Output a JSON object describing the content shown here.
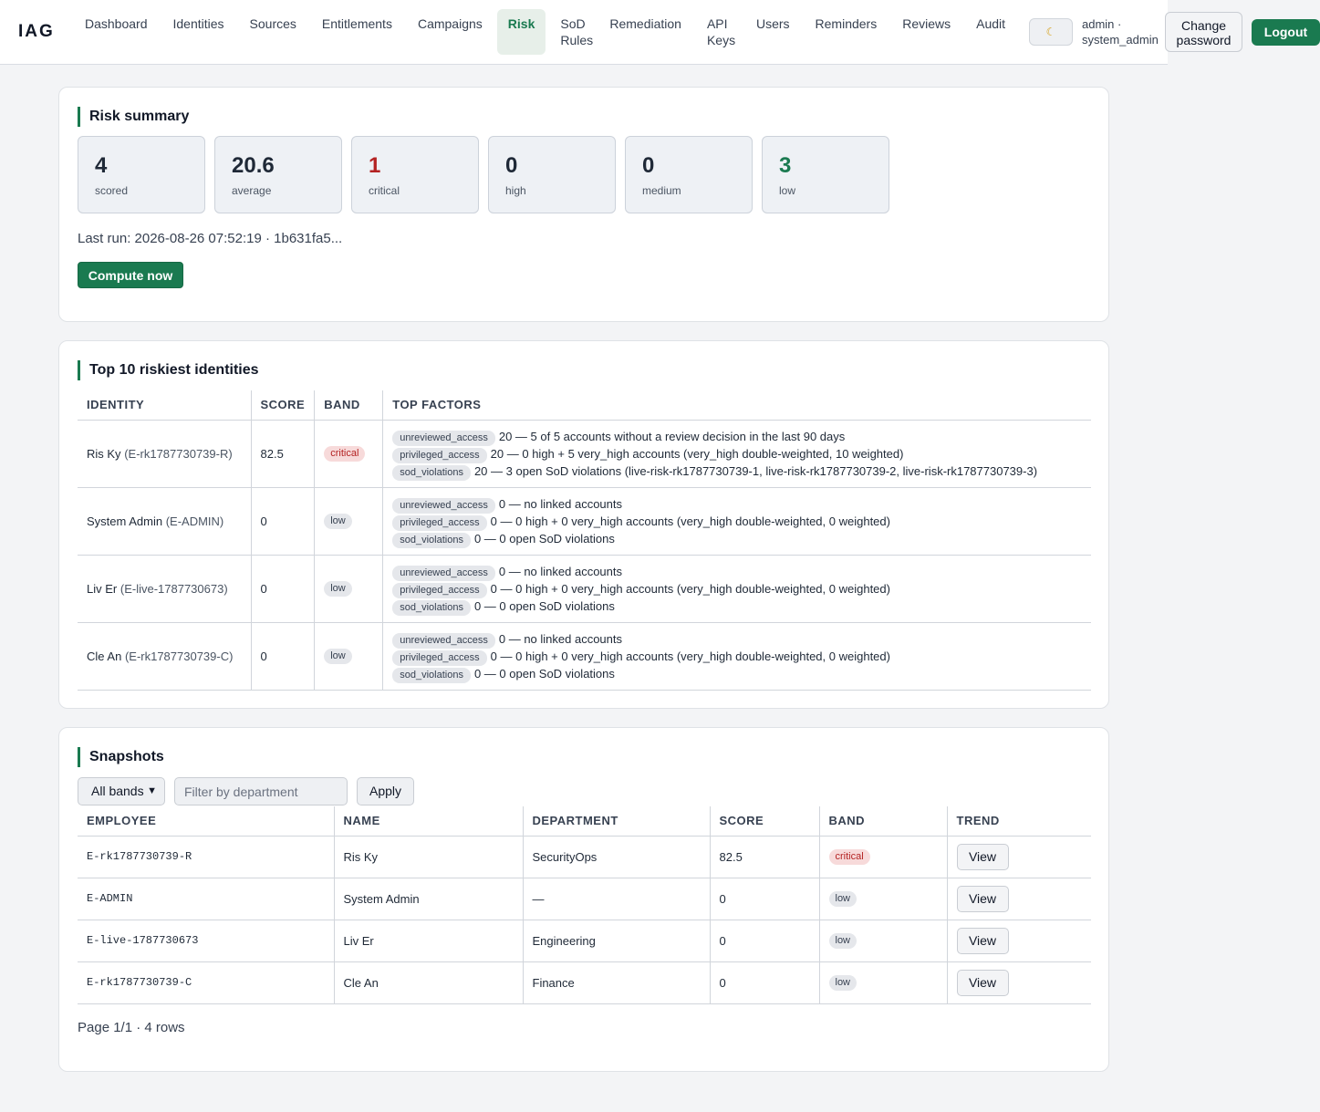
{
  "app": {
    "brand": "IAG"
  },
  "nav": {
    "items": [
      {
        "label": "Dashboard"
      },
      {
        "label": "Identities"
      },
      {
        "label": "Sources"
      },
      {
        "label": "Entitlements"
      },
      {
        "label": "Campaigns"
      },
      {
        "label": "Risk"
      },
      {
        "label": "SoD Rules"
      },
      {
        "label": "Remediation"
      },
      {
        "label": "API Keys"
      },
      {
        "label": "Users"
      },
      {
        "label": "Reminders"
      },
      {
        "label": "Reviews"
      },
      {
        "label": "Audit"
      }
    ],
    "active": "Risk",
    "theme_icon": "moon-icon",
    "user_label": "admin · system_admin",
    "change_password": "Change password",
    "logout": "Logout"
  },
  "summary": {
    "title": "Risk summary",
    "stats": [
      {
        "value": "4",
        "label": "scored"
      },
      {
        "value": "20.6",
        "label": "average"
      },
      {
        "value": "1",
        "label": "critical"
      },
      {
        "value": "0",
        "label": "high"
      },
      {
        "value": "0",
        "label": "medium"
      },
      {
        "value": "3",
        "label": "low"
      }
    ],
    "last_run": "Last run: 2026-08-26 07:52:19 · 1b631fa5...",
    "compute_button": "Compute now"
  },
  "top": {
    "title": "Top 10 riskiest identities",
    "headers": [
      "IDENTITY",
      "SCORE",
      "BAND",
      "TOP FACTORS"
    ],
    "rows": [
      {
        "name": "Ris Ky",
        "id": "(E-rk1787730739-R)",
        "score": "82.5",
        "band": "critical",
        "factors": [
          {
            "tag": "unreviewed_access",
            "text": "20 — 5 of 5 accounts without a review decision in the last 90 days"
          },
          {
            "tag": "privileged_access",
            "text": "20 — 0 high + 5 very_high accounts (very_high double-weighted, 10 weighted)"
          },
          {
            "tag": "sod_violations",
            "text": "20 — 3 open SoD violations (live-risk-rk1787730739-1, live-risk-rk1787730739-2, live-risk-rk1787730739-3)"
          }
        ]
      },
      {
        "name": "System Admin",
        "id": "(E-ADMIN)",
        "score": "0",
        "band": "low",
        "factors": [
          {
            "tag": "unreviewed_access",
            "text": "0 — no linked accounts"
          },
          {
            "tag": "privileged_access",
            "text": "0 — 0 high + 0 very_high accounts (very_high double-weighted, 0 weighted)"
          },
          {
            "tag": "sod_violations",
            "text": "0 — 0 open SoD violations"
          }
        ]
      },
      {
        "name": "Liv Er",
        "id": "(E-live-1787730673)",
        "score": "0",
        "band": "low",
        "factors": [
          {
            "tag": "unreviewed_access",
            "text": "0 — no linked accounts"
          },
          {
            "tag": "privileged_access",
            "text": "0 — 0 high + 0 very_high accounts (very_high double-weighted, 0 weighted)"
          },
          {
            "tag": "sod_violations",
            "text": "0 — 0 open SoD violations"
          }
        ]
      },
      {
        "name": "Cle An",
        "id": "(E-rk1787730739-C)",
        "score": "0",
        "band": "low",
        "factors": [
          {
            "tag": "unreviewed_access",
            "text": "0 — no linked accounts"
          },
          {
            "tag": "privileged_access",
            "text": "0 — 0 high + 0 very_high accounts (very_high double-weighted, 0 weighted)"
          },
          {
            "tag": "sod_violations",
            "text": "0 — 0 open SoD violations"
          }
        ]
      }
    ]
  },
  "snapshots": {
    "title": "Snapshots",
    "band_select": "All bands",
    "dept_placeholder": "Filter by department",
    "apply": "Apply",
    "headers": [
      "EMPLOYEE",
      "NAME",
      "DEPARTMENT",
      "SCORE",
      "BAND",
      "TREND"
    ],
    "rows": [
      {
        "employee": "E-rk1787730739-R",
        "name": "Ris Ky",
        "department": "SecurityOps",
        "score": "82.5",
        "band": "critical",
        "trend": "View"
      },
      {
        "employee": "E-ADMIN",
        "name": "System Admin",
        "department": "—",
        "score": "0",
        "band": "low",
        "trend": "View"
      },
      {
        "employee": "E-live-1787730673",
        "name": "Liv Er",
        "department": "Engineering",
        "score": "0",
        "band": "low",
        "trend": "View"
      },
      {
        "employee": "E-rk1787730739-C",
        "name": "Cle An",
        "department": "Finance",
        "score": "0",
        "band": "low",
        "trend": "View"
      }
    ],
    "pager": "Page 1/1 · 4 rows"
  },
  "colors": {
    "accent": "#1a7a50",
    "critical": "#b42323",
    "critical_bg": "#f7dada"
  }
}
